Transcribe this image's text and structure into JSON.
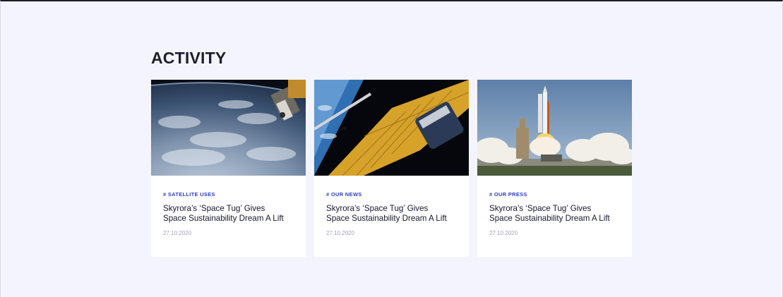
{
  "section": {
    "title": "ACTIVITY"
  },
  "cards": [
    {
      "image": "earth-from-orbit-photo",
      "tag": "# SATELLITE USES",
      "headline": "Skyrora’s ‘Space Tug’ Gives Space Sustainability Dream A Lift",
      "date": "27.10.2020"
    },
    {
      "image": "space-station-solar-panel-photo",
      "tag": "# OUR NEWS",
      "headline": "Skyrora’s ‘Space Tug’ Gives Space Sustainability Dream A Lift",
      "date": "27.10.2020"
    },
    {
      "image": "rocket-launch-photo",
      "tag": "# OUR PRESS",
      "headline": "Skyrora’s ‘Space Tug’ Gives Space Sustainability Dream A Lift",
      "date": "27.10.2020"
    }
  ],
  "colors": {
    "background": "#f4f4fe",
    "tag": "#2d3ec7",
    "heading": "#1e1f2e",
    "date": "#a2a3b6"
  }
}
